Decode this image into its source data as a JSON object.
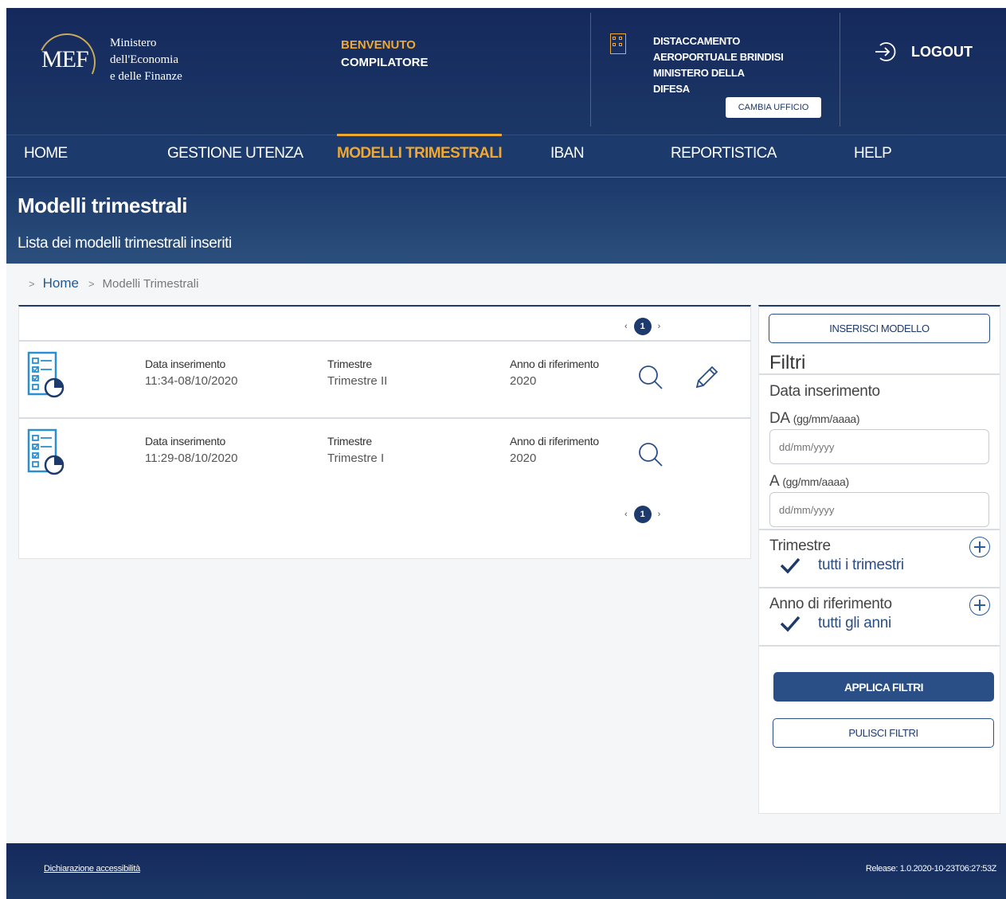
{
  "header": {
    "logo": {
      "mef": "MEF",
      "line1": "Ministero",
      "line2": "dell'Economia",
      "line3": "e delle Finanze"
    },
    "welcome": {
      "line1": "BENVENUTO",
      "line2": "COMPILATORE"
    },
    "office": {
      "lines": [
        "DISTACCAMENTO",
        "AEROPORTUALE BRINDISI",
        "MINISTERO DELLA",
        "DIFESA"
      ],
      "change_label": "CAMBIA UFFICIO"
    },
    "logout_label": "LOGOUT"
  },
  "nav": {
    "items": [
      {
        "label": "HOME"
      },
      {
        "label": "GESTIONE UTENZA"
      },
      {
        "label": "MODELLI TRIMESTRALI",
        "active": true
      },
      {
        "label": "IBAN"
      },
      {
        "label": "REPORTISTICA"
      },
      {
        "label": "HELP"
      }
    ]
  },
  "page": {
    "title": "Modelli trimestrali",
    "subtitle": "Lista dei modelli trimestrali inseriti"
  },
  "breadcrumb": {
    "sep": ">",
    "home": "Home",
    "current": "Modelli Trimestrali"
  },
  "pagination": {
    "current_page": "1",
    "prev": "‹",
    "next": "›"
  },
  "records": [
    {
      "date_label": "Data inserimento",
      "date_value": "11:34-08/10/2020",
      "quarter_label": "Trimestre",
      "quarter_value": "Trimestre II",
      "year_label": "Anno di riferimento",
      "year_value": "2020",
      "editable": true
    },
    {
      "date_label": "Data inserimento",
      "date_value": "11:29-08/10/2020",
      "quarter_label": "Trimestre",
      "quarter_value": "Trimestre I",
      "year_label": "Anno di riferimento",
      "year_value": "2020",
      "editable": false
    }
  ],
  "filters": {
    "insert_button": "INSERISCI MODELLO",
    "title": "Filtri",
    "date_section": "Data inserimento",
    "from_label": "DA",
    "from_hint": "(gg/mm/aaaa)",
    "from_placeholder": "dd/mm/yyyy",
    "to_label": "A",
    "to_hint": "(gg/mm/aaaa)",
    "to_placeholder": "dd/mm/yyyy",
    "quarter_section": "Trimestre",
    "quarter_option": "tutti i trimestri",
    "year_section": "Anno di riferimento",
    "year_option": "tutti gli anni",
    "apply_button": "APPLICA FILTRI",
    "clear_button": "PULISCI FILTRI"
  },
  "footer": {
    "accessibility": "Dichiarazione accessibilità",
    "release": "Release: 1.0.2020-10-23T06:27:53Z"
  },
  "colors": {
    "navy": "#1c3a6c",
    "accent": "#f0a830",
    "button": "#2a4e86"
  }
}
